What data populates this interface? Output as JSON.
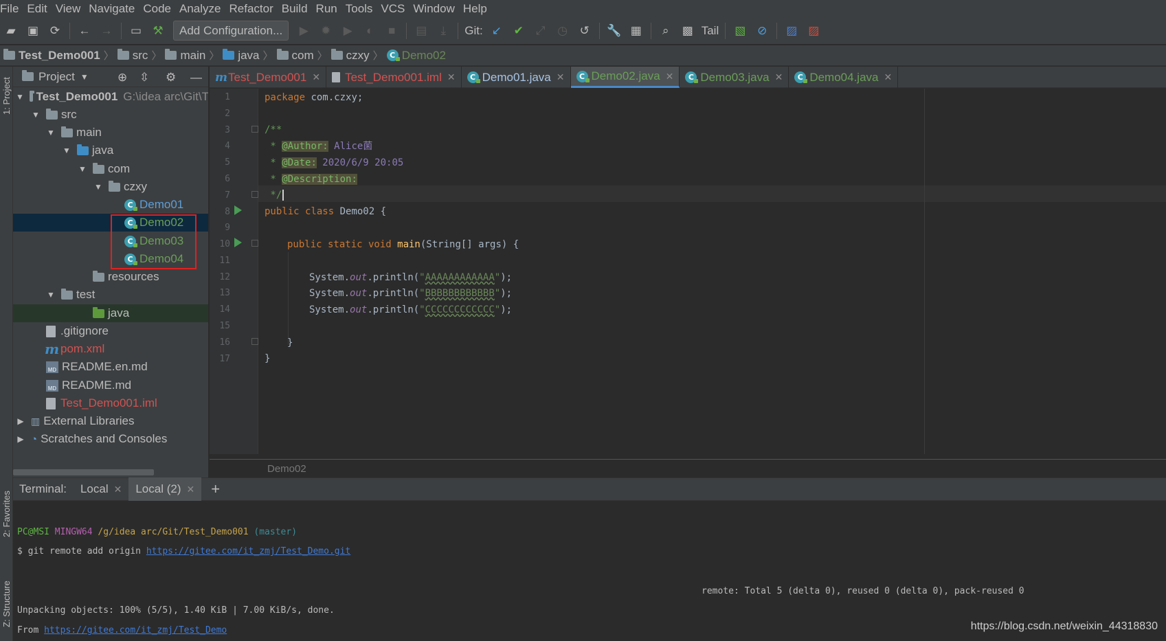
{
  "menu": [
    "File",
    "Edit",
    "View",
    "Navigate",
    "Code",
    "Analyze",
    "Refactor",
    "Build",
    "Run",
    "Tools",
    "VCS",
    "Window",
    "Help"
  ],
  "toolbar": {
    "config_label": "Add Configuration...",
    "git_label": "Git:",
    "tail_label": "Tail"
  },
  "breadcrumb": [
    "Test_Demo001",
    "src",
    "main",
    "java",
    "com",
    "czxy",
    "Demo02"
  ],
  "left_strip": {
    "project": "1: Project",
    "favorites": "2: Favorites",
    "structure": "Z: Structure"
  },
  "project_panel": {
    "title": "Project",
    "root_name": "Test_Demo001",
    "root_path": "G:\\idea arc\\Git\\T",
    "src": "src",
    "main": "main",
    "java": "java",
    "com": "com",
    "czxy": "czxy",
    "demo01": "Demo01",
    "demo02": "Demo02",
    "demo03": "Demo03",
    "demo04": "Demo04",
    "resources": "resources",
    "test": "test",
    "test_java": "java",
    "gitignore": ".gitignore",
    "pom": "pom.xml",
    "readme_en": "README.en.md",
    "readme": "README.md",
    "iml": "Test_Demo001.iml",
    "ext_libs": "External Libraries",
    "scratches": "Scratches and Consoles"
  },
  "tabs": [
    "Test_Demo001",
    "Test_Demo001.iml",
    "Demo01.java",
    "Demo02.java",
    "Demo03.java",
    "Demo04.java"
  ],
  "line_numbers": [
    "1",
    "2",
    "3",
    "4",
    "5",
    "6",
    "7",
    "8",
    "9",
    "10",
    "11",
    "12",
    "13",
    "14",
    "15",
    "16",
    "17"
  ],
  "code": {
    "pkg_kw": "package",
    "pkg_name": " com.czxy;",
    "doc_open": "/**",
    "doc_star": " * ",
    "author_tag": "@Author:",
    "author_val": " Alice菌",
    "date_tag": "@Date:",
    "date_val": " 2020/6/9 20:05",
    "desc_tag": "@Description:",
    "doc_close": " */",
    "class_kw": "public class",
    "class_name": " Demo02 {",
    "main_kw": "public static void",
    "main_name": " main",
    "main_args": "(String[] args) {",
    "sys": "System.",
    "out": "out",
    "println": ".println(",
    "quote": "\"",
    "str1": "AAAAAAAAAAAA",
    "str2": "BBBBBBBBBBBB",
    "str3": "CCCCCCCCCCCC",
    "end": ");",
    "brace_close": "}",
    "brace_close2": "}"
  },
  "editor_crumb": "Demo02",
  "terminal": {
    "label": "Terminal:",
    "tabs": [
      "Local",
      "Local (2)"
    ],
    "user": "PC@MSI",
    "shell": "MINGW64",
    "cwd": "/g/idea arc/Git/Test_Demo001",
    "branch": "(master)",
    "cmd": "$ git remote add origin ",
    "cmd_url": "https://gitee.com/it_zmj/Test_Demo.git",
    "remote_line": "remote: Total 5 (delta 0), reused 0 (delta 0), pack-reused 0",
    "unpack_line": "Unpacking objects: 100% (5/5), 1.40 KiB | 7.00 KiB/s, done.",
    "from": "From ",
    "from_url": "https://gitee.com/it_zmj/Test_Demo"
  },
  "watermark": "https://blog.csdn.net/weixin_44318830"
}
